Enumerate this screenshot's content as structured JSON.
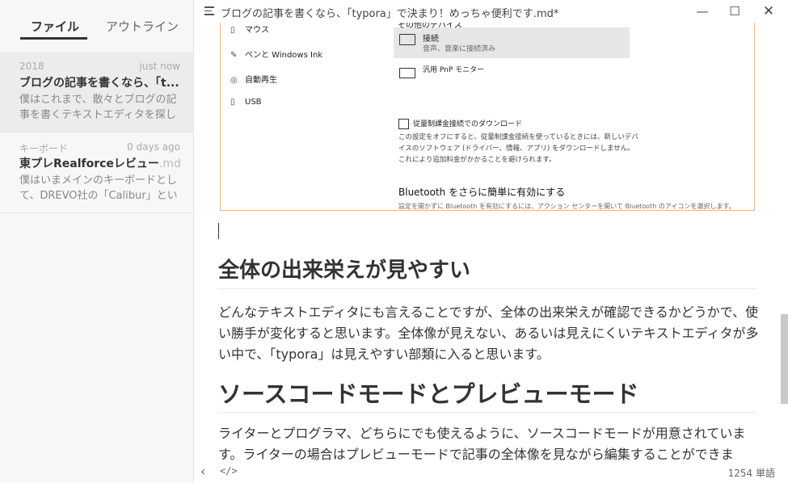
{
  "sidebar": {
    "tabs": {
      "files": "ファイル",
      "outline": "アウトライン"
    },
    "files": [
      {
        "folder": "2018",
        "time": "just now",
        "title": "ブログの記事を書くなら、「t...",
        "ext": "",
        "excerpt": "僕はこれまで、散々とブログの記事を書くテキストエディタを探し"
      },
      {
        "folder": "キーボード",
        "time": "0 days ago",
        "title": "東プレRealforceレビュー",
        "ext": ".md",
        "excerpt": "僕はいまメインのキーボードとして、DREVO社の「Calibur」とい"
      }
    ]
  },
  "titlebar": {
    "title": "ブログの記事を書くなら、「typora」で決まり！めっちゃ便利です.md*",
    "minimize": "—",
    "maximize": "☐",
    "close": "✕"
  },
  "editor": {
    "screenshot": {
      "left_items": [
        "マウス",
        "ペンと Windows Ink",
        "自動再生",
        "USB"
      ],
      "other_devices_heading": "その他のデバイス",
      "device_name": "接続",
      "device_sub": "音声、音楽に接続済み",
      "device2_name": "汎用 PnP モニター",
      "checkbox_label": "従量制課金接続でのダウンロード",
      "checkbox_desc": "この設定をオフにすると、従量制課金接続を使っているときには、新しいデバイスのソフトウェア (ドライバー、情報、アプリ) をダウンロードしません。これにより追加料金がかかることを避けられます。",
      "bt_title": "Bluetooth をさらに簡単に有効にする",
      "bt_desc": "設定を開かずに Bluetooth を有効にするには、アクション センターを開いて Bluetooth のアイコンを選択します。"
    },
    "heading1": "全体の出来栄えが見やすい",
    "para1": "どんなテキストエディタにも言えることですが、全体の出来栄えが確認できるかどうかで、使い勝手が変化すると思います。全体像が見えない、あるいは見えにくいテキストエディタが多い中で、「typora」は見えやすい部類に入ると思います。",
    "heading2": "ソースコードモードとプレビューモード",
    "para2": "ライターとプログラマ、どちらにでも使えるように、ソースコードモードが用意されています。ライターの場合はプレビューモードで記事の全体像を見ながら編集することができま"
  },
  "statusbar": {
    "back": "‹",
    "source_toggle": "</>",
    "word_count": "1254 単語"
  },
  "colors": {
    "sidebar_bg": "#f7f7f7",
    "active_file_bg": "#ececec",
    "image_border": "#e9b98c"
  }
}
